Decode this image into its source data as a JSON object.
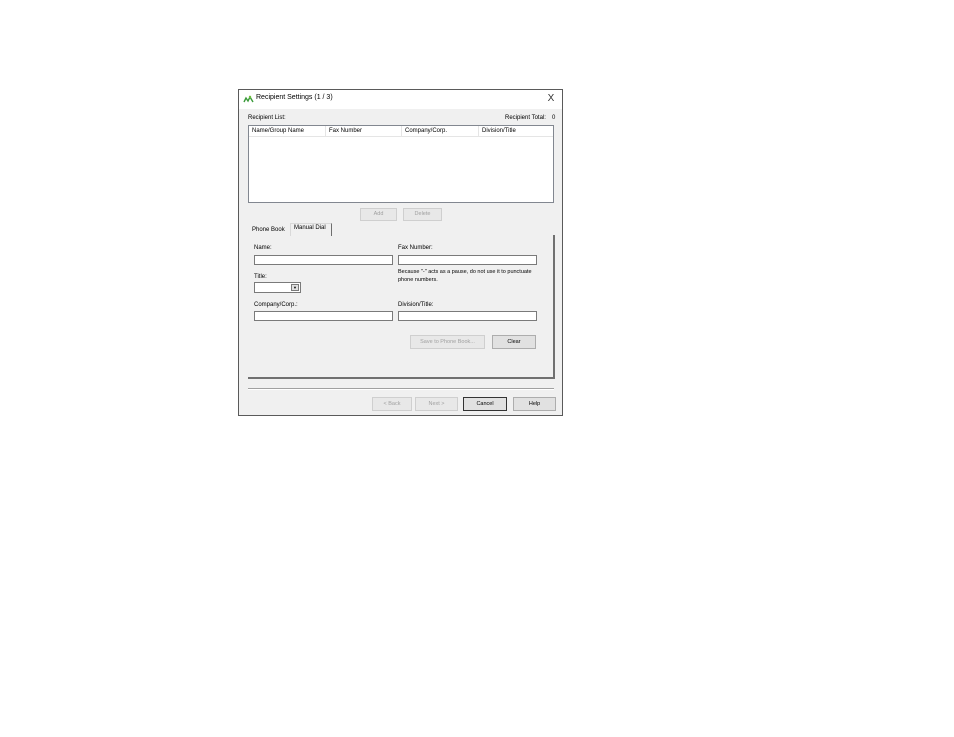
{
  "dialog": {
    "title": "Recipient Settings (1 / 3)",
    "close_label": "X",
    "icon": "fax-app-icon"
  },
  "recipient": {
    "list_label": "Recipient List:",
    "total_label": "Recipient Total:",
    "total_value": "0",
    "columns": [
      "Name/Group Name",
      "Fax Number",
      "Company/Corp.",
      "Division/Title"
    ]
  },
  "list_buttons": {
    "add": "Add",
    "delete": "Delete"
  },
  "tabs": [
    "Phone Book",
    "Manual Dial"
  ],
  "form": {
    "name_label": "Name:",
    "name_value": "",
    "fax_label": "Fax Number:",
    "fax_value": "",
    "note": "Because \"-\" acts as a pause, do not use it to punctuate phone numbers.",
    "title_label": "Title:",
    "title_value": "",
    "company_label": "Company/Corp.:",
    "company_value": "",
    "division_label": "Division/Title:",
    "division_value": "",
    "save_button": "Save to Phone Book...",
    "clear_button": "Clear"
  },
  "footer": {
    "back": "< Back",
    "next": "Next >",
    "cancel": "Cancel",
    "help": "Help"
  }
}
